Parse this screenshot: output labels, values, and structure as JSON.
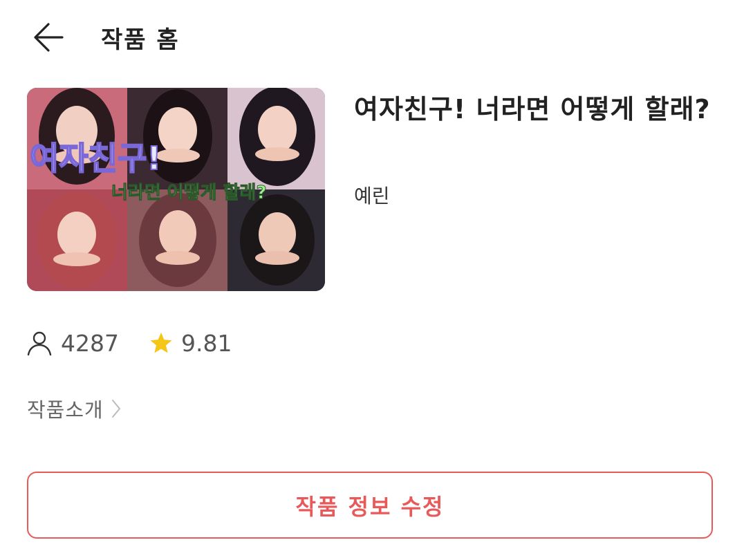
{
  "header": {
    "title": "작품 홈"
  },
  "work": {
    "cover_text_line1": "여자친구!",
    "cover_text_line2": "너라면 어떻게 할래?",
    "title": "여자친구! 너라면 어떻게 할래?",
    "author": "예린"
  },
  "stats": {
    "views": "4287",
    "rating": "9.81"
  },
  "intro": {
    "label": "작품소개"
  },
  "edit_button": {
    "label": "작품 정보 수정"
  },
  "colors": {
    "accent": "#e85a5a",
    "star": "#f5c518"
  }
}
